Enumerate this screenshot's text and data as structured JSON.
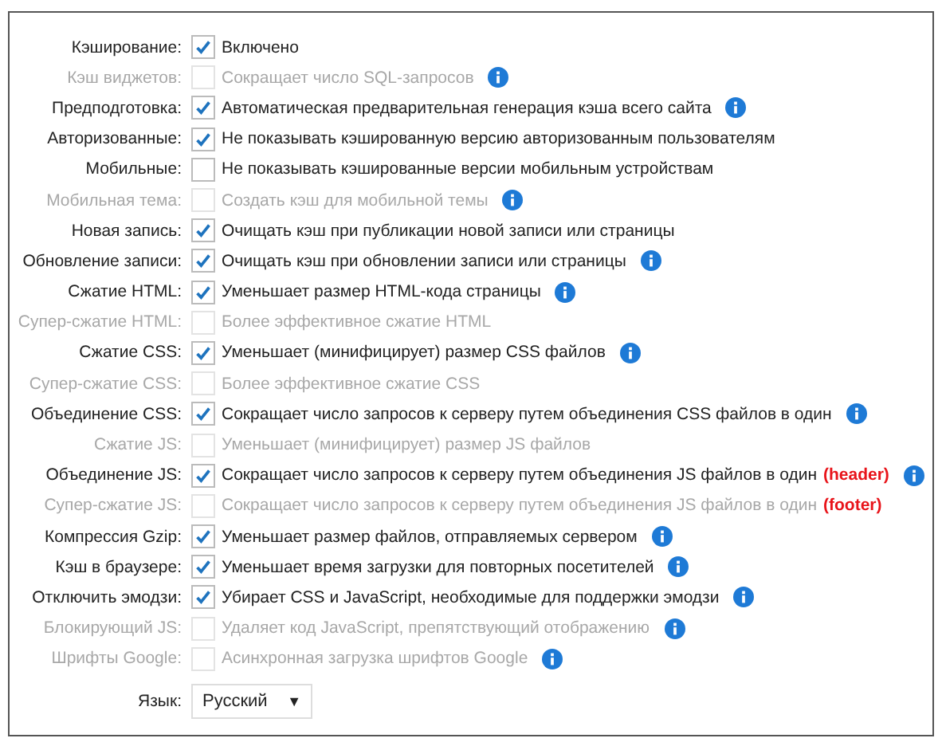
{
  "settings": [
    {
      "label": "Кэширование:",
      "checked": true,
      "disabled": false,
      "description": "Включено",
      "info": false
    },
    {
      "label": "Кэш виджетов:",
      "checked": false,
      "disabled": true,
      "description": "Сокращает число SQL-запросов",
      "info": true
    },
    {
      "label": "Предподготовка:",
      "checked": true,
      "disabled": false,
      "description": "Автоматическая предварительная генерация кэша всего сайта",
      "info": true
    },
    {
      "label": "Авторизованные:",
      "checked": true,
      "disabled": false,
      "description": "Не показывать кэшированную версию авторизованным пользователям",
      "info": false
    },
    {
      "label": "Мобильные:",
      "checked": false,
      "disabled": false,
      "description": "Не показывать кэшированные версии мобильным устройствам",
      "info": false
    },
    {
      "label": "Мобильная тема:",
      "checked": false,
      "disabled": true,
      "description": "Создать кэш для мобильной темы",
      "info": true
    },
    {
      "label": "Новая запись:",
      "checked": true,
      "disabled": false,
      "description": "Очищать кэш при публикации новой записи или страницы",
      "info": false
    },
    {
      "label": "Обновление записи:",
      "checked": true,
      "disabled": false,
      "description": "Очищать кэш при обновлении записи или страницы",
      "info": true
    },
    {
      "label": "Сжатие HTML:",
      "checked": true,
      "disabled": false,
      "description": "Уменьшает размер HTML-кода страницы",
      "info": true
    },
    {
      "label": "Супер-сжатие HTML:",
      "checked": false,
      "disabled": true,
      "description": "Более эффективное сжатие HTML",
      "info": false
    },
    {
      "label": "Сжатие CSS:",
      "checked": true,
      "disabled": false,
      "description": "Уменьшает (минифицирует) размер CSS файлов",
      "info": true
    },
    {
      "label": "Супер-сжатие CSS:",
      "checked": false,
      "disabled": true,
      "description": "Более эффективное сжатие CSS",
      "info": false
    },
    {
      "label": "Объединение CSS:",
      "checked": true,
      "disabled": false,
      "description": "Сокращает число запросов к серверу путем объединения CSS файлов в один",
      "info": true
    },
    {
      "label": "Сжатие JS:",
      "checked": false,
      "disabled": true,
      "description": "Уменьшает (минифицирует) размер JS файлов",
      "info": false
    },
    {
      "label": "Объединение JS:",
      "checked": true,
      "disabled": false,
      "description": "Сокращает число запросов к серверу путем объединения JS файлов в один",
      "note": "(header)",
      "info": true
    },
    {
      "label": "Супер-сжатие JS:",
      "checked": false,
      "disabled": true,
      "description": "Сокращает число запросов к серверу путем объединения JS файлов в один",
      "note": "(footer)",
      "info": false
    },
    {
      "label": "Компрессия Gzip:",
      "checked": true,
      "disabled": false,
      "description": "Уменьшает размер файлов, отправляемых сервером",
      "info": true
    },
    {
      "label": "Кэш в браузере:",
      "checked": true,
      "disabled": false,
      "description": "Уменьшает время загрузки для повторных посетителей",
      "info": true
    },
    {
      "label": "Отключить эмодзи:",
      "checked": true,
      "disabled": false,
      "description": "Убирает CSS и JavaScript, необходимые для поддержки эмодзи",
      "info": true
    },
    {
      "label": "Блокирующий JS:",
      "checked": false,
      "disabled": true,
      "description": "Удаляет код JavaScript, препятствующий отображению",
      "info": true
    },
    {
      "label": "Шрифты Google:",
      "checked": false,
      "disabled": true,
      "description": "Асинхронная загрузка шрифтов Google",
      "info": true
    }
  ],
  "language": {
    "label": "Язык:",
    "value": "Русский",
    "arrow": "▼"
  }
}
